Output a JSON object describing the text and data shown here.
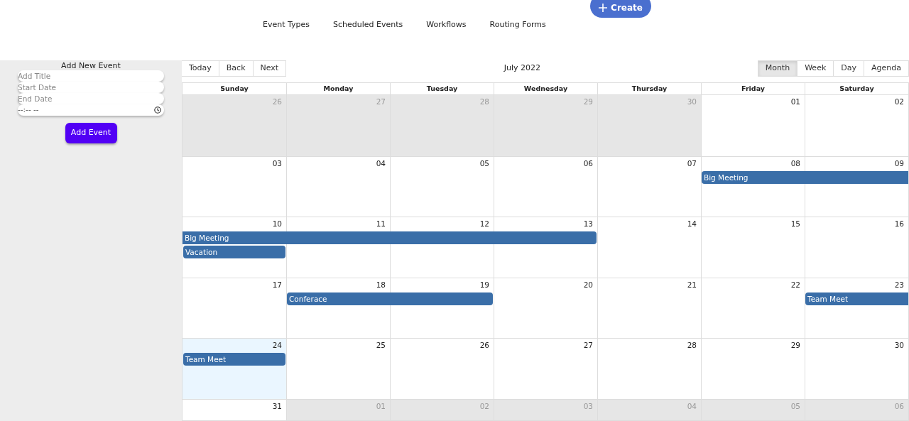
{
  "header": {
    "create_button": "Create",
    "nav": [
      "Event Types",
      "Scheduled Events",
      "Workflows",
      "Routing Forms"
    ]
  },
  "sidebar": {
    "title": "Add New Event",
    "fields": [
      {
        "placeholder": "Add Title"
      },
      {
        "placeholder": "Start Date"
      },
      {
        "placeholder": "End Date"
      }
    ],
    "time_field": {
      "value": "--:-- --"
    },
    "button": "Add Event"
  },
  "calendar": {
    "nav_buttons": [
      "Today",
      "Back",
      "Next"
    ],
    "label": "July 2022",
    "views": [
      {
        "label": "Month",
        "selected": true
      },
      {
        "label": "Week",
        "selected": false
      },
      {
        "label": "Day",
        "selected": false
      },
      {
        "label": "Agenda",
        "selected": false
      }
    ],
    "weekdays": [
      "Sunday",
      "Monday",
      "Tuesday",
      "Wednesday",
      "Thursday",
      "Friday",
      "Saturday"
    ],
    "weeks": [
      {
        "days": [
          {
            "date": "26",
            "off_range": true,
            "today": false
          },
          {
            "date": "27",
            "off_range": true,
            "today": false
          },
          {
            "date": "28",
            "off_range": true,
            "today": false
          },
          {
            "date": "29",
            "off_range": true,
            "today": false
          },
          {
            "date": "30",
            "off_range": true,
            "today": false
          },
          {
            "date": "01",
            "off_range": false,
            "today": false
          },
          {
            "date": "02",
            "off_range": false,
            "today": false
          }
        ]
      },
      {
        "days": [
          {
            "date": "03",
            "off_range": false,
            "today": false
          },
          {
            "date": "04",
            "off_range": false,
            "today": false
          },
          {
            "date": "05",
            "off_range": false,
            "today": false
          },
          {
            "date": "06",
            "off_range": false,
            "today": false
          },
          {
            "date": "07",
            "off_range": false,
            "today": false
          },
          {
            "date": "08",
            "off_range": false,
            "today": false
          },
          {
            "date": "09",
            "off_range": false,
            "today": false
          }
        ],
        "events": [
          {
            "title": "Big Meeting",
            "continues_before": false,
            "continues_after": true
          }
        ]
      },
      {
        "days": [
          {
            "date": "10",
            "off_range": false,
            "today": false
          },
          {
            "date": "11",
            "off_range": false,
            "today": false
          },
          {
            "date": "12",
            "off_range": false,
            "today": false
          },
          {
            "date": "13",
            "off_range": false,
            "today": false
          },
          {
            "date": "14",
            "off_range": false,
            "today": false
          },
          {
            "date": "15",
            "off_range": false,
            "today": false
          },
          {
            "date": "16",
            "off_range": false,
            "today": false
          }
        ],
        "events": [
          {
            "title": "Big Meeting",
            "continues_before": true,
            "continues_after": false
          },
          {
            "title": "Vacation",
            "continues_before": false,
            "continues_after": false
          }
        ]
      },
      {
        "days": [
          {
            "date": "17",
            "off_range": false,
            "today": false
          },
          {
            "date": "18",
            "off_range": false,
            "today": false
          },
          {
            "date": "19",
            "off_range": false,
            "today": false
          },
          {
            "date": "20",
            "off_range": false,
            "today": false
          },
          {
            "date": "21",
            "off_range": false,
            "today": false
          },
          {
            "date": "22",
            "off_range": false,
            "today": false
          },
          {
            "date": "23",
            "off_range": false,
            "today": false
          }
        ],
        "events": [
          {
            "title": "Conferace",
            "continues_before": false,
            "continues_after": false
          },
          {
            "title": "Team Meet",
            "continues_before": false,
            "continues_after": true
          }
        ]
      },
      {
        "days": [
          {
            "date": "24",
            "off_range": false,
            "today": true
          },
          {
            "date": "25",
            "off_range": false,
            "today": false
          },
          {
            "date": "26",
            "off_range": false,
            "today": false
          },
          {
            "date": "27",
            "off_range": false,
            "today": false
          },
          {
            "date": "28",
            "off_range": false,
            "today": false
          },
          {
            "date": "29",
            "off_range": false,
            "today": false
          },
          {
            "date": "30",
            "off_range": false,
            "today": false
          }
        ],
        "events": [
          {
            "title": "Team Meet",
            "continues_before": false,
            "continues_after": false
          }
        ]
      },
      {
        "days": [
          {
            "date": "31",
            "off_range": false,
            "today": false
          },
          {
            "date": "01",
            "off_range": true,
            "today": false
          },
          {
            "date": "02",
            "off_range": true,
            "today": false
          },
          {
            "date": "03",
            "off_range": true,
            "today": false
          },
          {
            "date": "04",
            "off_range": true,
            "today": false
          },
          {
            "date": "05",
            "off_range": true,
            "today": false
          },
          {
            "date": "06",
            "off_range": true,
            "today": false
          }
        ]
      }
    ]
  }
}
